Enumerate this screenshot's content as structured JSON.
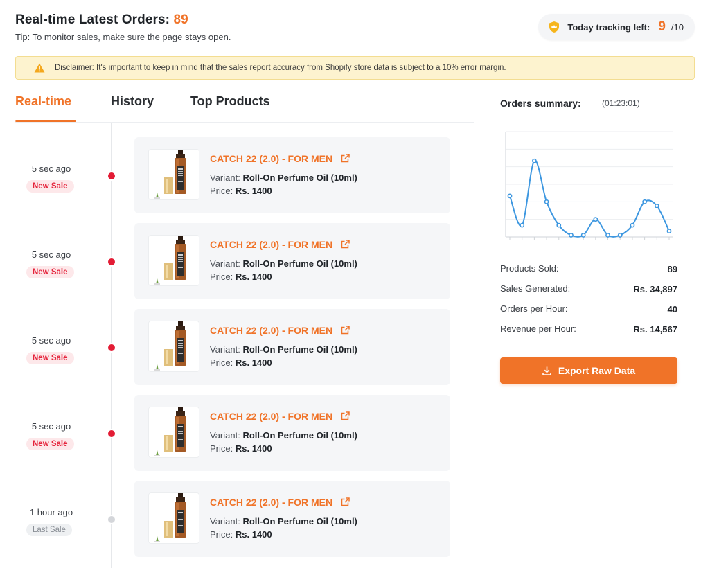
{
  "header": {
    "title": "Real-time Latest Orders:",
    "order_count": "89",
    "tip": "Tip: To monitor sales, make sure the page stays open."
  },
  "tracking": {
    "label": "Today tracking left:",
    "used": "9",
    "separator": "/10",
    "icon": "shield-crown-icon"
  },
  "disclaimer": {
    "icon": "warning-icon",
    "text": "Disclaimer: It's important to keep in mind that the sales report accuracy from Shopify store data is subject to a 10% error margin."
  },
  "tabs": [
    {
      "label": "Real-time",
      "active": true
    },
    {
      "label": "History",
      "active": false
    },
    {
      "label": "Top Products",
      "active": false
    }
  ],
  "orders": [
    {
      "time": "5 sec ago",
      "badge": "New Sale",
      "status": "new",
      "product": "CATCH 22 (2.0) - FOR MEN",
      "variant_label": "Variant:",
      "variant": "Roll-On Perfume Oil (10ml)",
      "price_label": "Price:",
      "price": "Rs. 1400"
    },
    {
      "time": "5 sec ago",
      "badge": "New Sale",
      "status": "new",
      "product": "CATCH 22 (2.0) - FOR MEN",
      "variant_label": "Variant:",
      "variant": "Roll-On Perfume Oil (10ml)",
      "price_label": "Price:",
      "price": "Rs. 1400"
    },
    {
      "time": "5 sec ago",
      "badge": "New Sale",
      "status": "new",
      "product": "CATCH 22 (2.0) - FOR MEN",
      "variant_label": "Variant:",
      "variant": "Roll-On Perfume Oil (10ml)",
      "price_label": "Price:",
      "price": "Rs. 1400"
    },
    {
      "time": "5 sec ago",
      "badge": "New Sale",
      "status": "new",
      "product": "CATCH 22 (2.0) - FOR MEN",
      "variant_label": "Variant:",
      "variant": "Roll-On Perfume Oil (10ml)",
      "price_label": "Price:",
      "price": "Rs. 1400"
    },
    {
      "time": "1 hour ago",
      "badge": "Last Sale",
      "status": "last",
      "product": "CATCH 22 (2.0) - FOR MEN",
      "variant_label": "Variant:",
      "variant": "Roll-On Perfume Oil (10ml)",
      "price_label": "Price:",
      "price": "Rs. 1400"
    }
  ],
  "summary": {
    "title": "Orders summary:",
    "timer": "(01:23:01)",
    "stats": [
      {
        "label": "Products Sold:",
        "value": "89"
      },
      {
        "label": "Sales Generated:",
        "value": "Rs. 34,897"
      },
      {
        "label": "Orders per Hour:",
        "value": "40"
      },
      {
        "label": "Revenue per Hour:",
        "value": "Rs. 14,567"
      }
    ],
    "export_label": "Export Raw Data",
    "export_icon": "download-icon"
  },
  "chart_data": {
    "type": "line",
    "title": "",
    "xlabel": "",
    "ylabel": "",
    "x": [
      1,
      2,
      3,
      4,
      5,
      6,
      7,
      8,
      9,
      10,
      11,
      12,
      13,
      14
    ],
    "series": [
      {
        "values": [
          7,
          2,
          13,
          6,
          2,
          0.3,
          0.3,
          3,
          0.3,
          0.3,
          2,
          6,
          5.3,
          1
        ]
      }
    ],
    "ylim": [
      0,
      18
    ],
    "grid": true,
    "color": "#3d97e0"
  },
  "colors": {
    "accent": "#f07328",
    "new_sale": "#e31c35",
    "last_sale": "#d4d6da",
    "line": "#3d97e0"
  }
}
